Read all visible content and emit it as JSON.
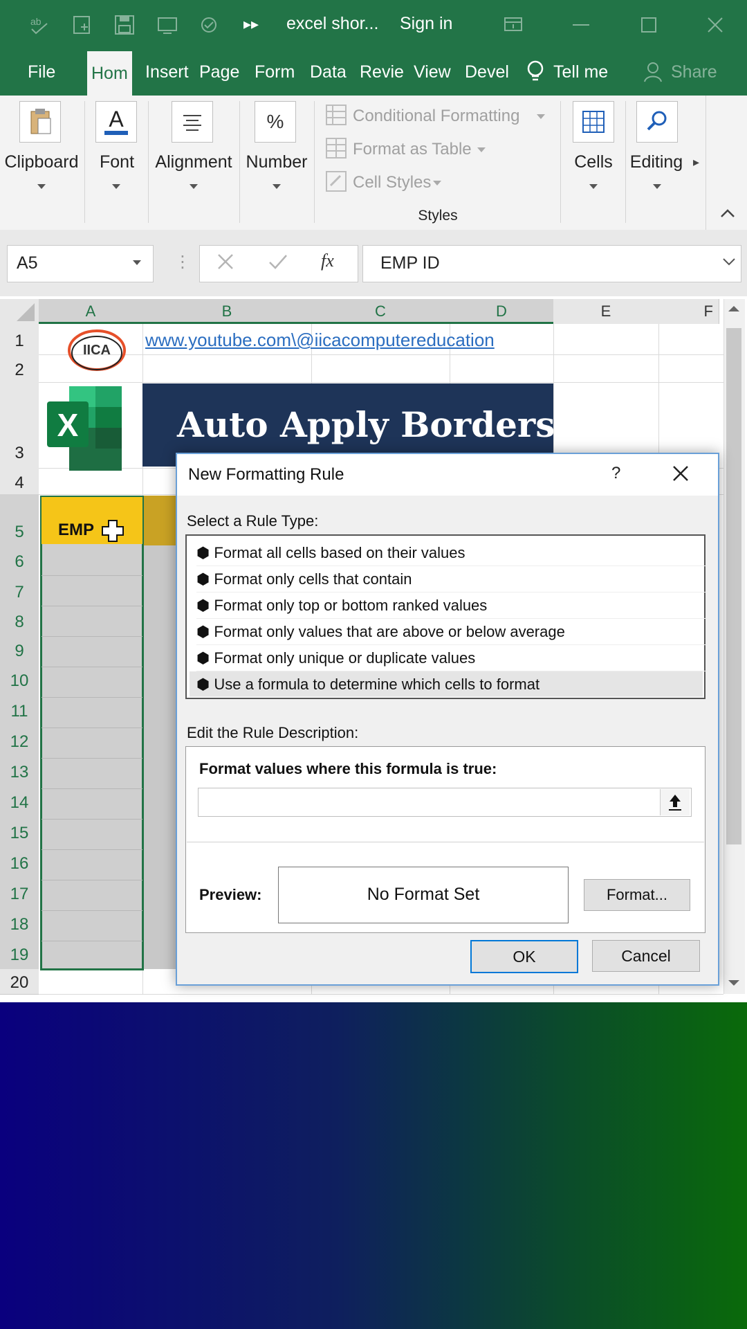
{
  "titlebar": {
    "filename": "excel shor...",
    "signin": "Sign in"
  },
  "tabs": [
    "File",
    "Hom",
    "Insert",
    "Page",
    "Form",
    "Data",
    "Revie",
    "View",
    "Devel"
  ],
  "tellme": "Tell me",
  "share": "Share",
  "ribbon": {
    "clipboard": "Clipboard",
    "font": "Font",
    "alignment": "Alignment",
    "number": "Number",
    "cond_format": "Conditional Formatting",
    "format_table": "Format as Table",
    "cell_styles": "Cell Styles",
    "styles": "Styles",
    "cells": "Cells",
    "editing": "Editing",
    "font_icon_letter": "A",
    "number_icon": "%"
  },
  "formula_bar": {
    "namebox": "A5",
    "fx": "fx",
    "value": "EMP ID"
  },
  "sheet": {
    "columns": [
      "A",
      "B",
      "C",
      "D",
      "E",
      "F"
    ],
    "rows": [
      "1",
      "2",
      "3",
      "4",
      "5",
      "6",
      "7",
      "8",
      "9",
      "10",
      "11",
      "12",
      "13",
      "14",
      "15",
      "16",
      "17",
      "18",
      "19",
      "20"
    ],
    "link": "www.youtube.com\\@iicacomputereducation",
    "logo_text": "IICA",
    "banner": "Auto Apply Borders",
    "excel_letter": "X",
    "a5": "EMP"
  },
  "dialog": {
    "title": "New Formatting Rule",
    "help": "?",
    "select_label": "Select a Rule Type:",
    "rules": [
      "Format all cells based on their values",
      "Format only cells that contain",
      "Format only top or bottom ranked values",
      "Format only values that are above or below average",
      "Format only unique or duplicate values",
      "Use a formula to determine which cells to format"
    ],
    "edit_label": "Edit the Rule Description:",
    "formula_label": "Format values where this formula is true:",
    "formula_value": "",
    "preview_label": "Preview:",
    "preview_text": "No Format Set",
    "format_btn": "Format...",
    "ok": "OK",
    "cancel": "Cancel"
  },
  "colors": {
    "excel_green": "#227447",
    "banner_bg": "#1e3458",
    "header_yellow": "#f5c518"
  }
}
